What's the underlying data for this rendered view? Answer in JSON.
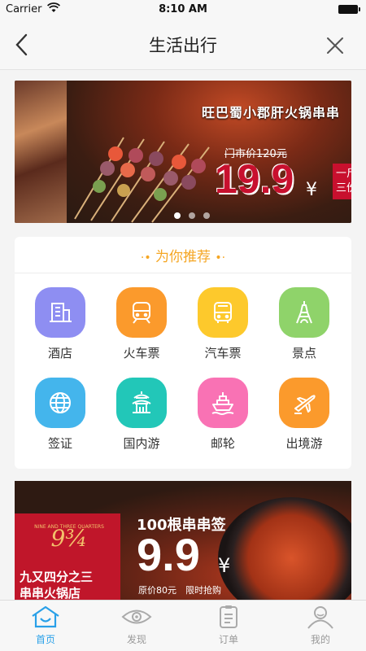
{
  "status_bar": {
    "carrier": "Carrier",
    "time": "8:10 AM"
  },
  "nav": {
    "title": "生活出行"
  },
  "banner1": {
    "headline": "旺巴蜀小郡肝火锅串串",
    "original_price": "门市价120元",
    "price": "19.9",
    "currency": "¥",
    "tag_line1": "一斤套",
    "tag_line2": "三份套",
    "slide_count": 3,
    "active_slide": 0
  },
  "recommend": {
    "title": "为你推荐",
    "items": [
      {
        "label": "酒店",
        "icon": "hotel-icon",
        "color": "#8e8ef2"
      },
      {
        "label": "火车票",
        "icon": "train-icon",
        "color": "#fb9a2c"
      },
      {
        "label": "汽车票",
        "icon": "bus-icon",
        "color": "#fdc92c"
      },
      {
        "label": "景点",
        "icon": "eiffel-tower-icon",
        "color": "#8fd36a"
      },
      {
        "label": "签证",
        "icon": "globe-icon",
        "color": "#44b5ec"
      },
      {
        "label": "国内游",
        "icon": "temple-icon",
        "color": "#22c7b8"
      },
      {
        "label": "邮轮",
        "icon": "cruise-ship-icon",
        "color": "#f972b4"
      },
      {
        "label": "出境游",
        "icon": "airplane-icon",
        "color": "#fb9a2c"
      }
    ]
  },
  "banner2": {
    "store_line1": "九又四分之三",
    "store_line2": "串串火锅店",
    "logo_text": "9¾",
    "logo_caption": "NINE AND THREE QUARTERS",
    "promo": "100根串串签",
    "price": "9.9",
    "currency": "¥",
    "original_price": "原价80元",
    "limited": "限时抢购"
  },
  "tabs": [
    {
      "label": "首页",
      "icon": "home-icon",
      "active": true
    },
    {
      "label": "发现",
      "icon": "eye-icon",
      "active": false
    },
    {
      "label": "订单",
      "icon": "order-icon",
      "active": false
    },
    {
      "label": "我的",
      "icon": "user-icon",
      "active": false
    }
  ],
  "colors": {
    "accent": "#29a0e8",
    "recommend_title": "#f5a623",
    "price_red": "#c8102e"
  }
}
